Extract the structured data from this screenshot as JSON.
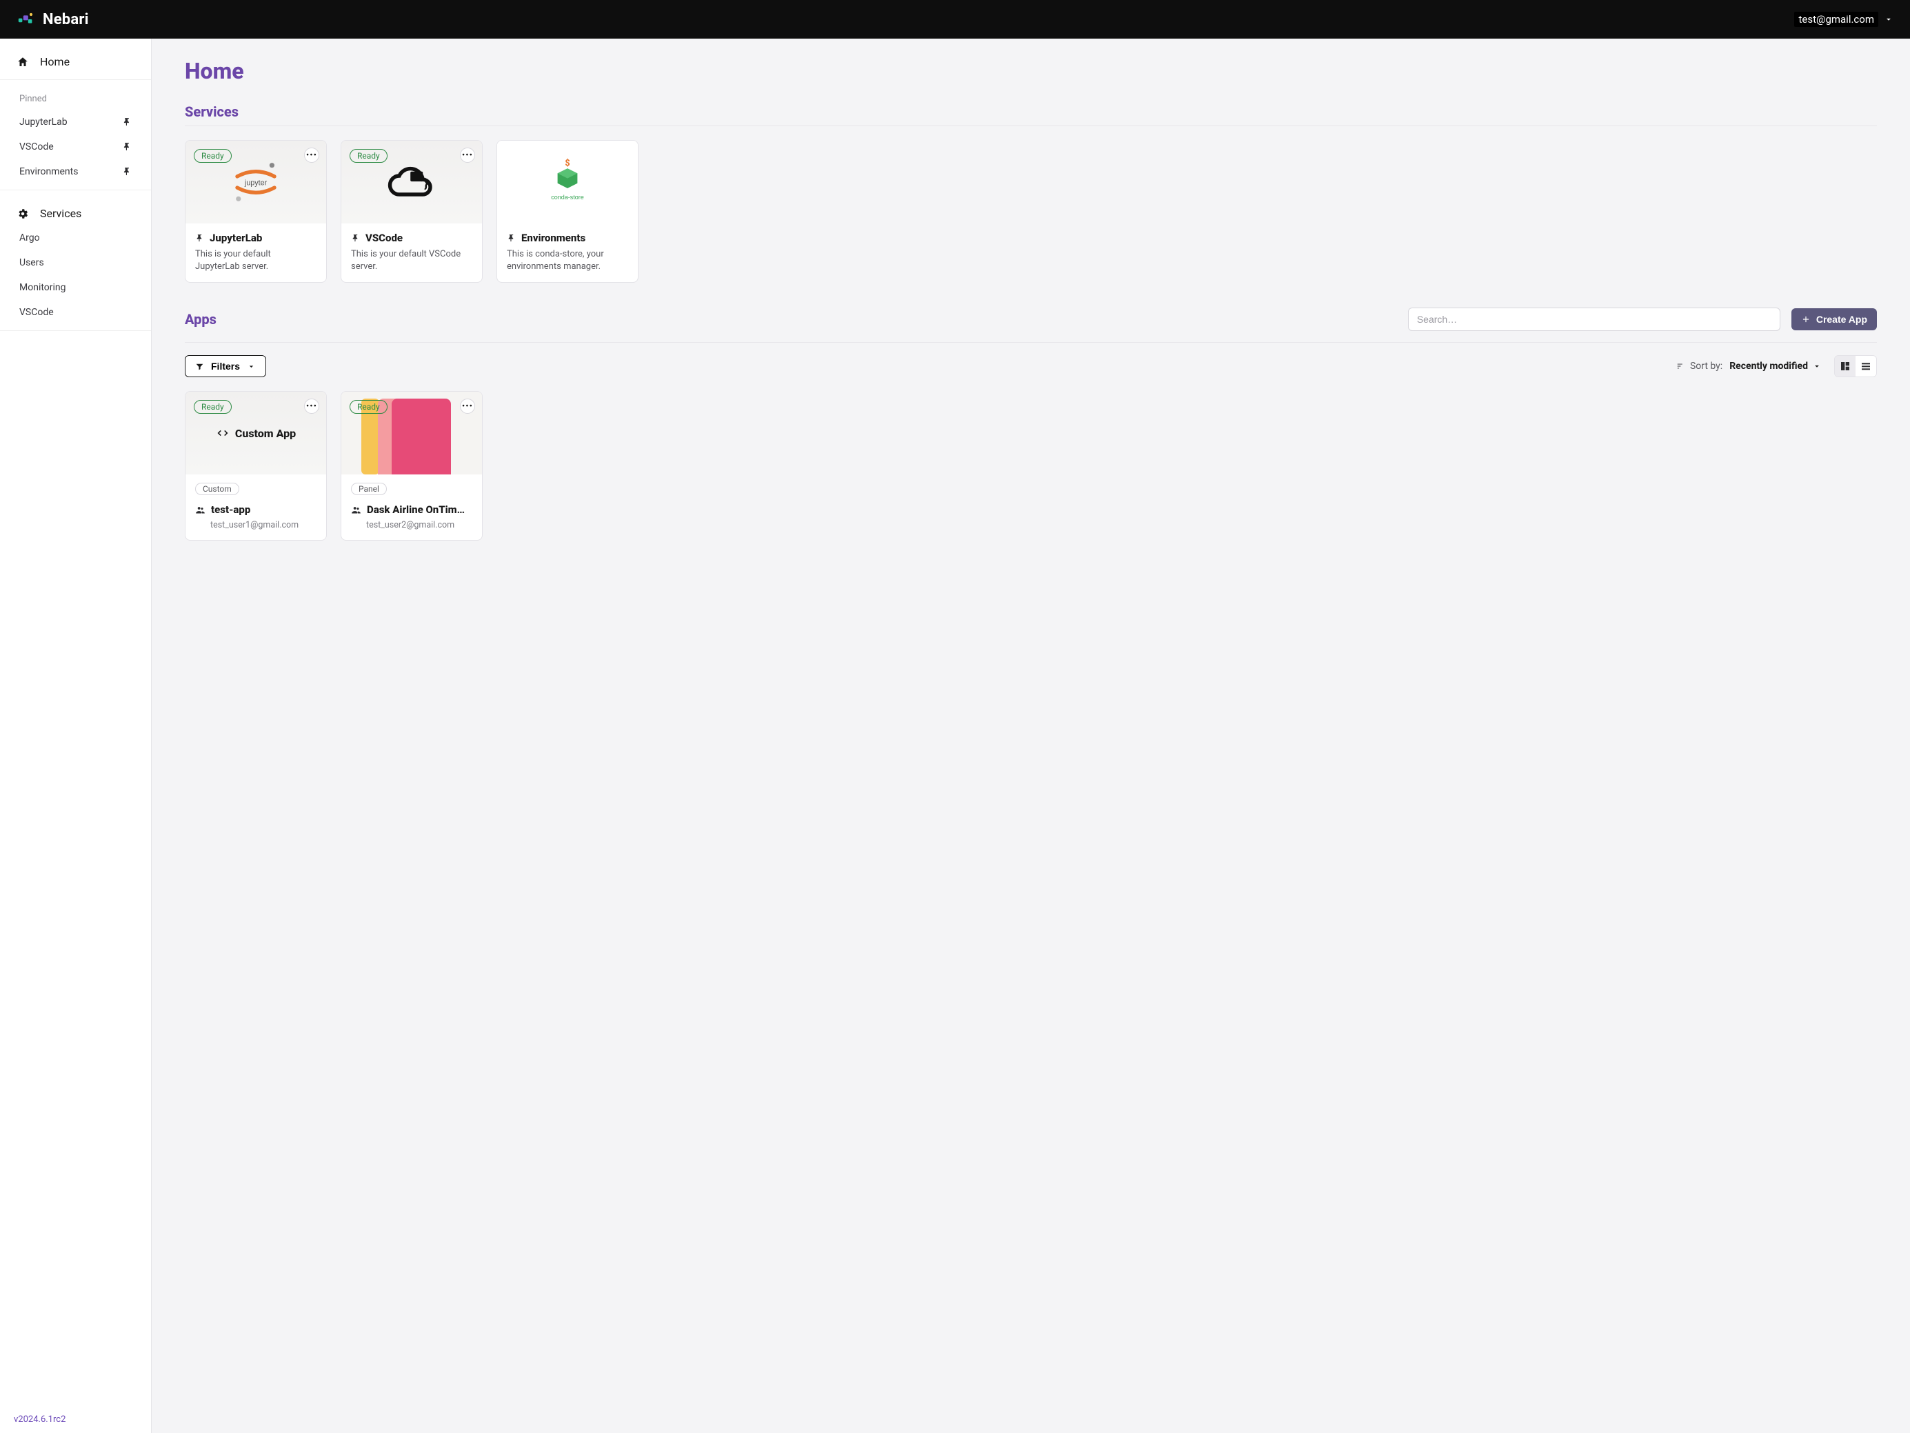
{
  "brand": {
    "name": "Nebari"
  },
  "user": {
    "email": "test@gmail.com"
  },
  "sidebar": {
    "home_label": "Home",
    "pinned_header": "Pinned",
    "pinned": [
      {
        "label": "JupyterLab"
      },
      {
        "label": "VSCode"
      },
      {
        "label": "Environments"
      }
    ],
    "services_header": "Services",
    "services": [
      {
        "label": "Argo"
      },
      {
        "label": "Users"
      },
      {
        "label": "Monitoring"
      },
      {
        "label": "VSCode"
      }
    ]
  },
  "version": "v2024.6.1rc2",
  "page": {
    "title": "Home"
  },
  "services_section": {
    "heading": "Services",
    "cards": [
      {
        "status": "Ready",
        "title": "JupyterLab",
        "desc": "This is your default JupyterLab server."
      },
      {
        "status": "Ready",
        "title": "VSCode",
        "desc": "This is your default VSCode server."
      },
      {
        "status": null,
        "title": "Environments",
        "desc": "This is conda-store, your environments manager."
      }
    ]
  },
  "apps_section": {
    "heading": "Apps",
    "search_placeholder": "Search…",
    "create_label": "Create App",
    "filters_label": "Filters",
    "sort_by_label": "Sort by:",
    "sort_value": "Recently modified",
    "custom_thumb_label": "Custom App",
    "cards": [
      {
        "status": "Ready",
        "chip": "Custom",
        "title": "test-app",
        "owner": "test_user1@gmail.com"
      },
      {
        "status": "Ready",
        "chip": "Panel",
        "title": "Dask Airline OnTim…",
        "owner": "test_user2@gmail.com"
      }
    ]
  }
}
